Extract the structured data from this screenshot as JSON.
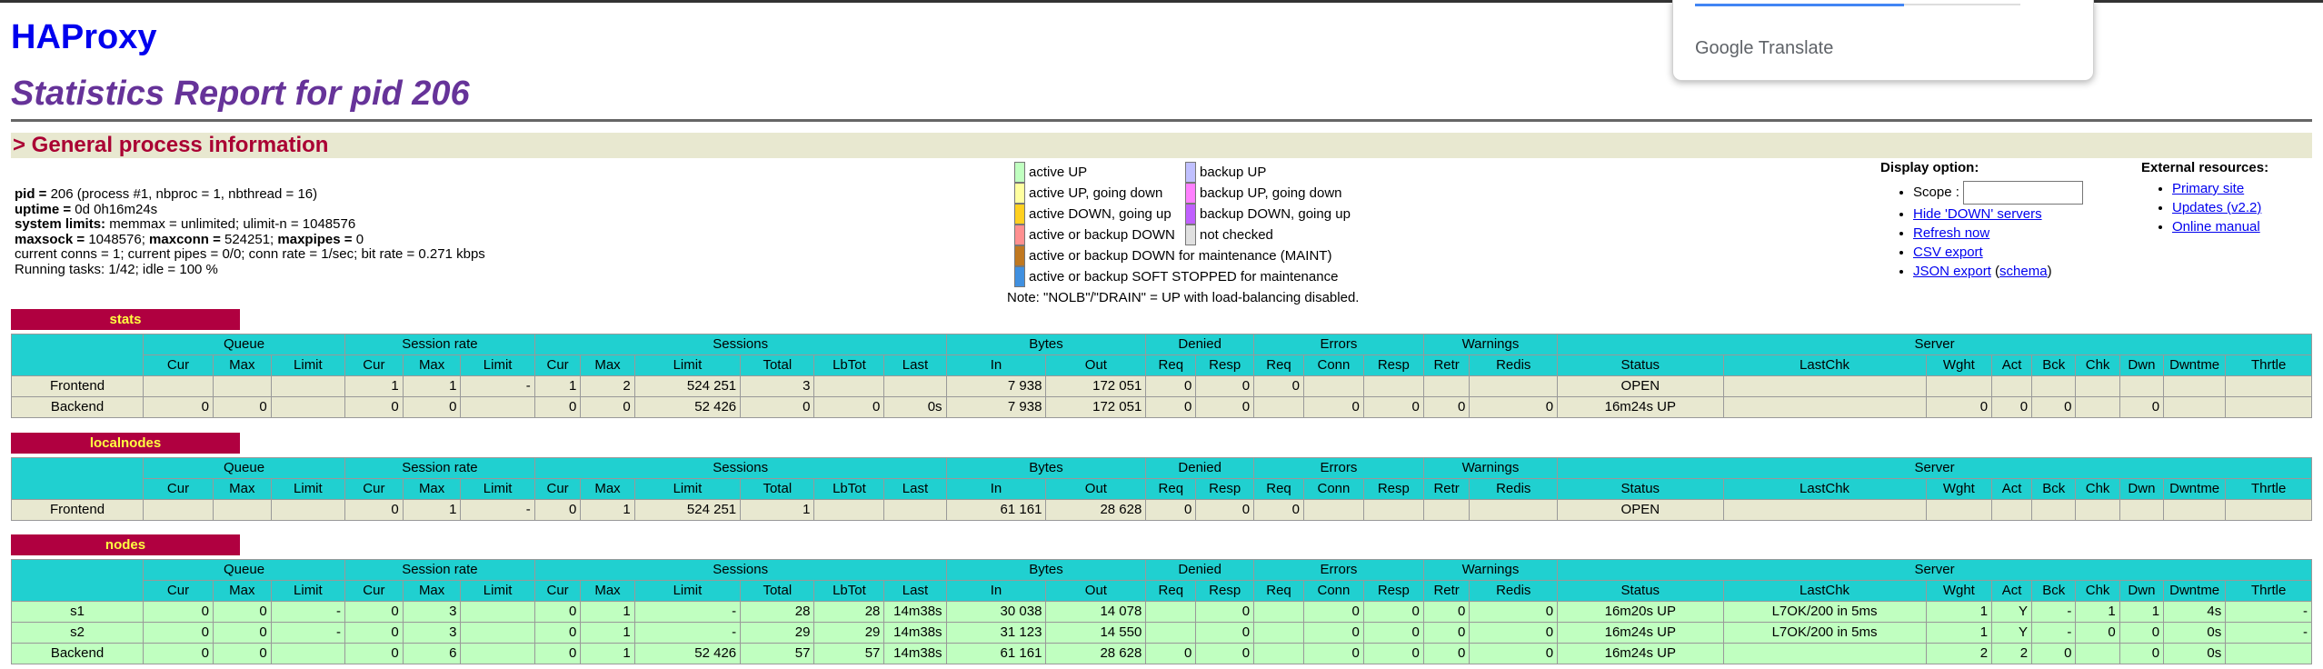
{
  "brand": "HAProxy",
  "title": "Statistics Report for pid 206",
  "section": "> General process information",
  "procinfo": {
    "l1_key": "pid = ",
    "l1_val": "206 (process #1, nbproc = 1, nbthread = 16)",
    "l2_key": "uptime = ",
    "l2_val": "0d 0h16m24s",
    "l3_key": "system limits:",
    "l3_val": " memmax = unlimited; ulimit-n = 1048576",
    "l4_k1": "maxsock = ",
    "l4_v1": "1048576; ",
    "l4_k2": "maxconn = ",
    "l4_v2": "524251; ",
    "l4_k3": "maxpipes = ",
    "l4_v3": "0",
    "l5": "current conns = 1; current pipes = 0/0; conn rate = 1/sec; bit rate = 0.271 kbps",
    "l6": "Running tasks: 1/42; idle = 100 %"
  },
  "legend_left": [
    {
      "color": "#c0ffc0",
      "label": "active UP"
    },
    {
      "color": "#ffffa0",
      "label": "active UP, going down"
    },
    {
      "color": "#ffd020",
      "label": "active DOWN, going up"
    },
    {
      "color": "#ff9090",
      "label": "active or backup DOWN"
    },
    {
      "color": "#c07820",
      "label": "active or backup DOWN for maintenance (MAINT)"
    },
    {
      "color": "#4090e0",
      "label": "active or backup SOFT STOPPED for maintenance"
    }
  ],
  "legend_right": [
    {
      "color": "#c0c0ff",
      "label": "backup UP"
    },
    {
      "color": "#ff80ff",
      "label": "backup UP, going down"
    },
    {
      "color": "#c060ff",
      "label": "backup DOWN, going up"
    },
    {
      "color": "#e0e0e0",
      "label": "not checked"
    }
  ],
  "note": "Note: \"NOLB\"/\"DRAIN\" = UP with load-balancing disabled.",
  "display": {
    "heading": "Display option:",
    "scope_label": "Scope :",
    "links": [
      "Hide 'DOWN' servers",
      "Refresh now",
      "CSV export"
    ],
    "json_export": "JSON export",
    "schema": "schema"
  },
  "external": {
    "heading": "External resources:",
    "links": [
      "Primary site",
      "Updates (v2.2)",
      "Online manual"
    ]
  },
  "translate": {
    "label": "Google Translate"
  },
  "headers": {
    "groups": [
      "Queue",
      "Session rate",
      "Sessions",
      "Bytes",
      "Denied",
      "Errors",
      "Warnings",
      "Server"
    ],
    "cols": [
      "Cur",
      "Max",
      "Limit",
      "Cur",
      "Max",
      "Limit",
      "Cur",
      "Max",
      "Limit",
      "Total",
      "LbTot",
      "Last",
      "In",
      "Out",
      "Req",
      "Resp",
      "Req",
      "Conn",
      "Resp",
      "Retr",
      "Redis",
      "Status",
      "LastChk",
      "Wght",
      "Act",
      "Bck",
      "Chk",
      "Dwn",
      "Dwntme",
      "Thrtle"
    ]
  },
  "proxies": [
    {
      "name": "stats",
      "rows": [
        {
          "cls": "fe",
          "cells": [
            "Frontend",
            "",
            "",
            "",
            "1",
            "1",
            "-",
            "1",
            "2",
            "524 251",
            "3",
            "",
            "",
            "7 938",
            "172 051",
            "0",
            "0",
            "0",
            "",
            "",
            "",
            "",
            "OPEN",
            "",
            "",
            "",
            "",
            "",
            "",
            "",
            ""
          ]
        },
        {
          "cls": "fe",
          "cells": [
            "Backend",
            "0",
            "0",
            "",
            "0",
            "0",
            "",
            "0",
            "0",
            "52 426",
            "0",
            "0",
            "0s",
            "7 938",
            "172 051",
            "0",
            "0",
            "",
            "0",
            "0",
            "0",
            "0",
            "16m24s UP",
            "",
            "0",
            "0",
            "0",
            "",
            "0",
            "",
            ""
          ]
        }
      ]
    },
    {
      "name": "localnodes",
      "rows": [
        {
          "cls": "fe",
          "cells": [
            "Frontend",
            "",
            "",
            "",
            "0",
            "1",
            "-",
            "0",
            "1",
            "524 251",
            "1",
            "",
            "",
            "61 161",
            "28 628",
            "0",
            "0",
            "0",
            "",
            "",
            "",
            "",
            "OPEN",
            "",
            "",
            "",
            "",
            "",
            "",
            "",
            ""
          ]
        }
      ]
    },
    {
      "name": "nodes",
      "rows": [
        {
          "cls": "up",
          "cells": [
            "s1",
            "0",
            "0",
            "-",
            "0",
            "3",
            "",
            "0",
            "1",
            "-",
            "28",
            "28",
            "14m38s",
            "30 038",
            "14 078",
            "",
            "0",
            "",
            "0",
            "0",
            "0",
            "0",
            "16m20s UP",
            "L7OK/200 in 5ms",
            "1",
            "Y",
            "-",
            "1",
            "1",
            "4s",
            "-"
          ]
        },
        {
          "cls": "up",
          "cells": [
            "s2",
            "0",
            "0",
            "-",
            "0",
            "3",
            "",
            "0",
            "1",
            "-",
            "29",
            "29",
            "14m38s",
            "31 123",
            "14 550",
            "",
            "0",
            "",
            "0",
            "0",
            "0",
            "0",
            "16m24s UP",
            "L7OK/200 in 5ms",
            "1",
            "Y",
            "-",
            "0",
            "0",
            "0s",
            "-"
          ]
        },
        {
          "cls": "up",
          "cells": [
            "Backend",
            "0",
            "0",
            "",
            "0",
            "6",
            "",
            "0",
            "1",
            "52 426",
            "57",
            "57",
            "14m38s",
            "61 161",
            "28 628",
            "0",
            "0",
            "",
            "0",
            "0",
            "0",
            "0",
            "16m24s UP",
            "",
            "2",
            "2",
            "0",
            "",
            "0",
            "0s",
            ""
          ]
        }
      ]
    }
  ]
}
